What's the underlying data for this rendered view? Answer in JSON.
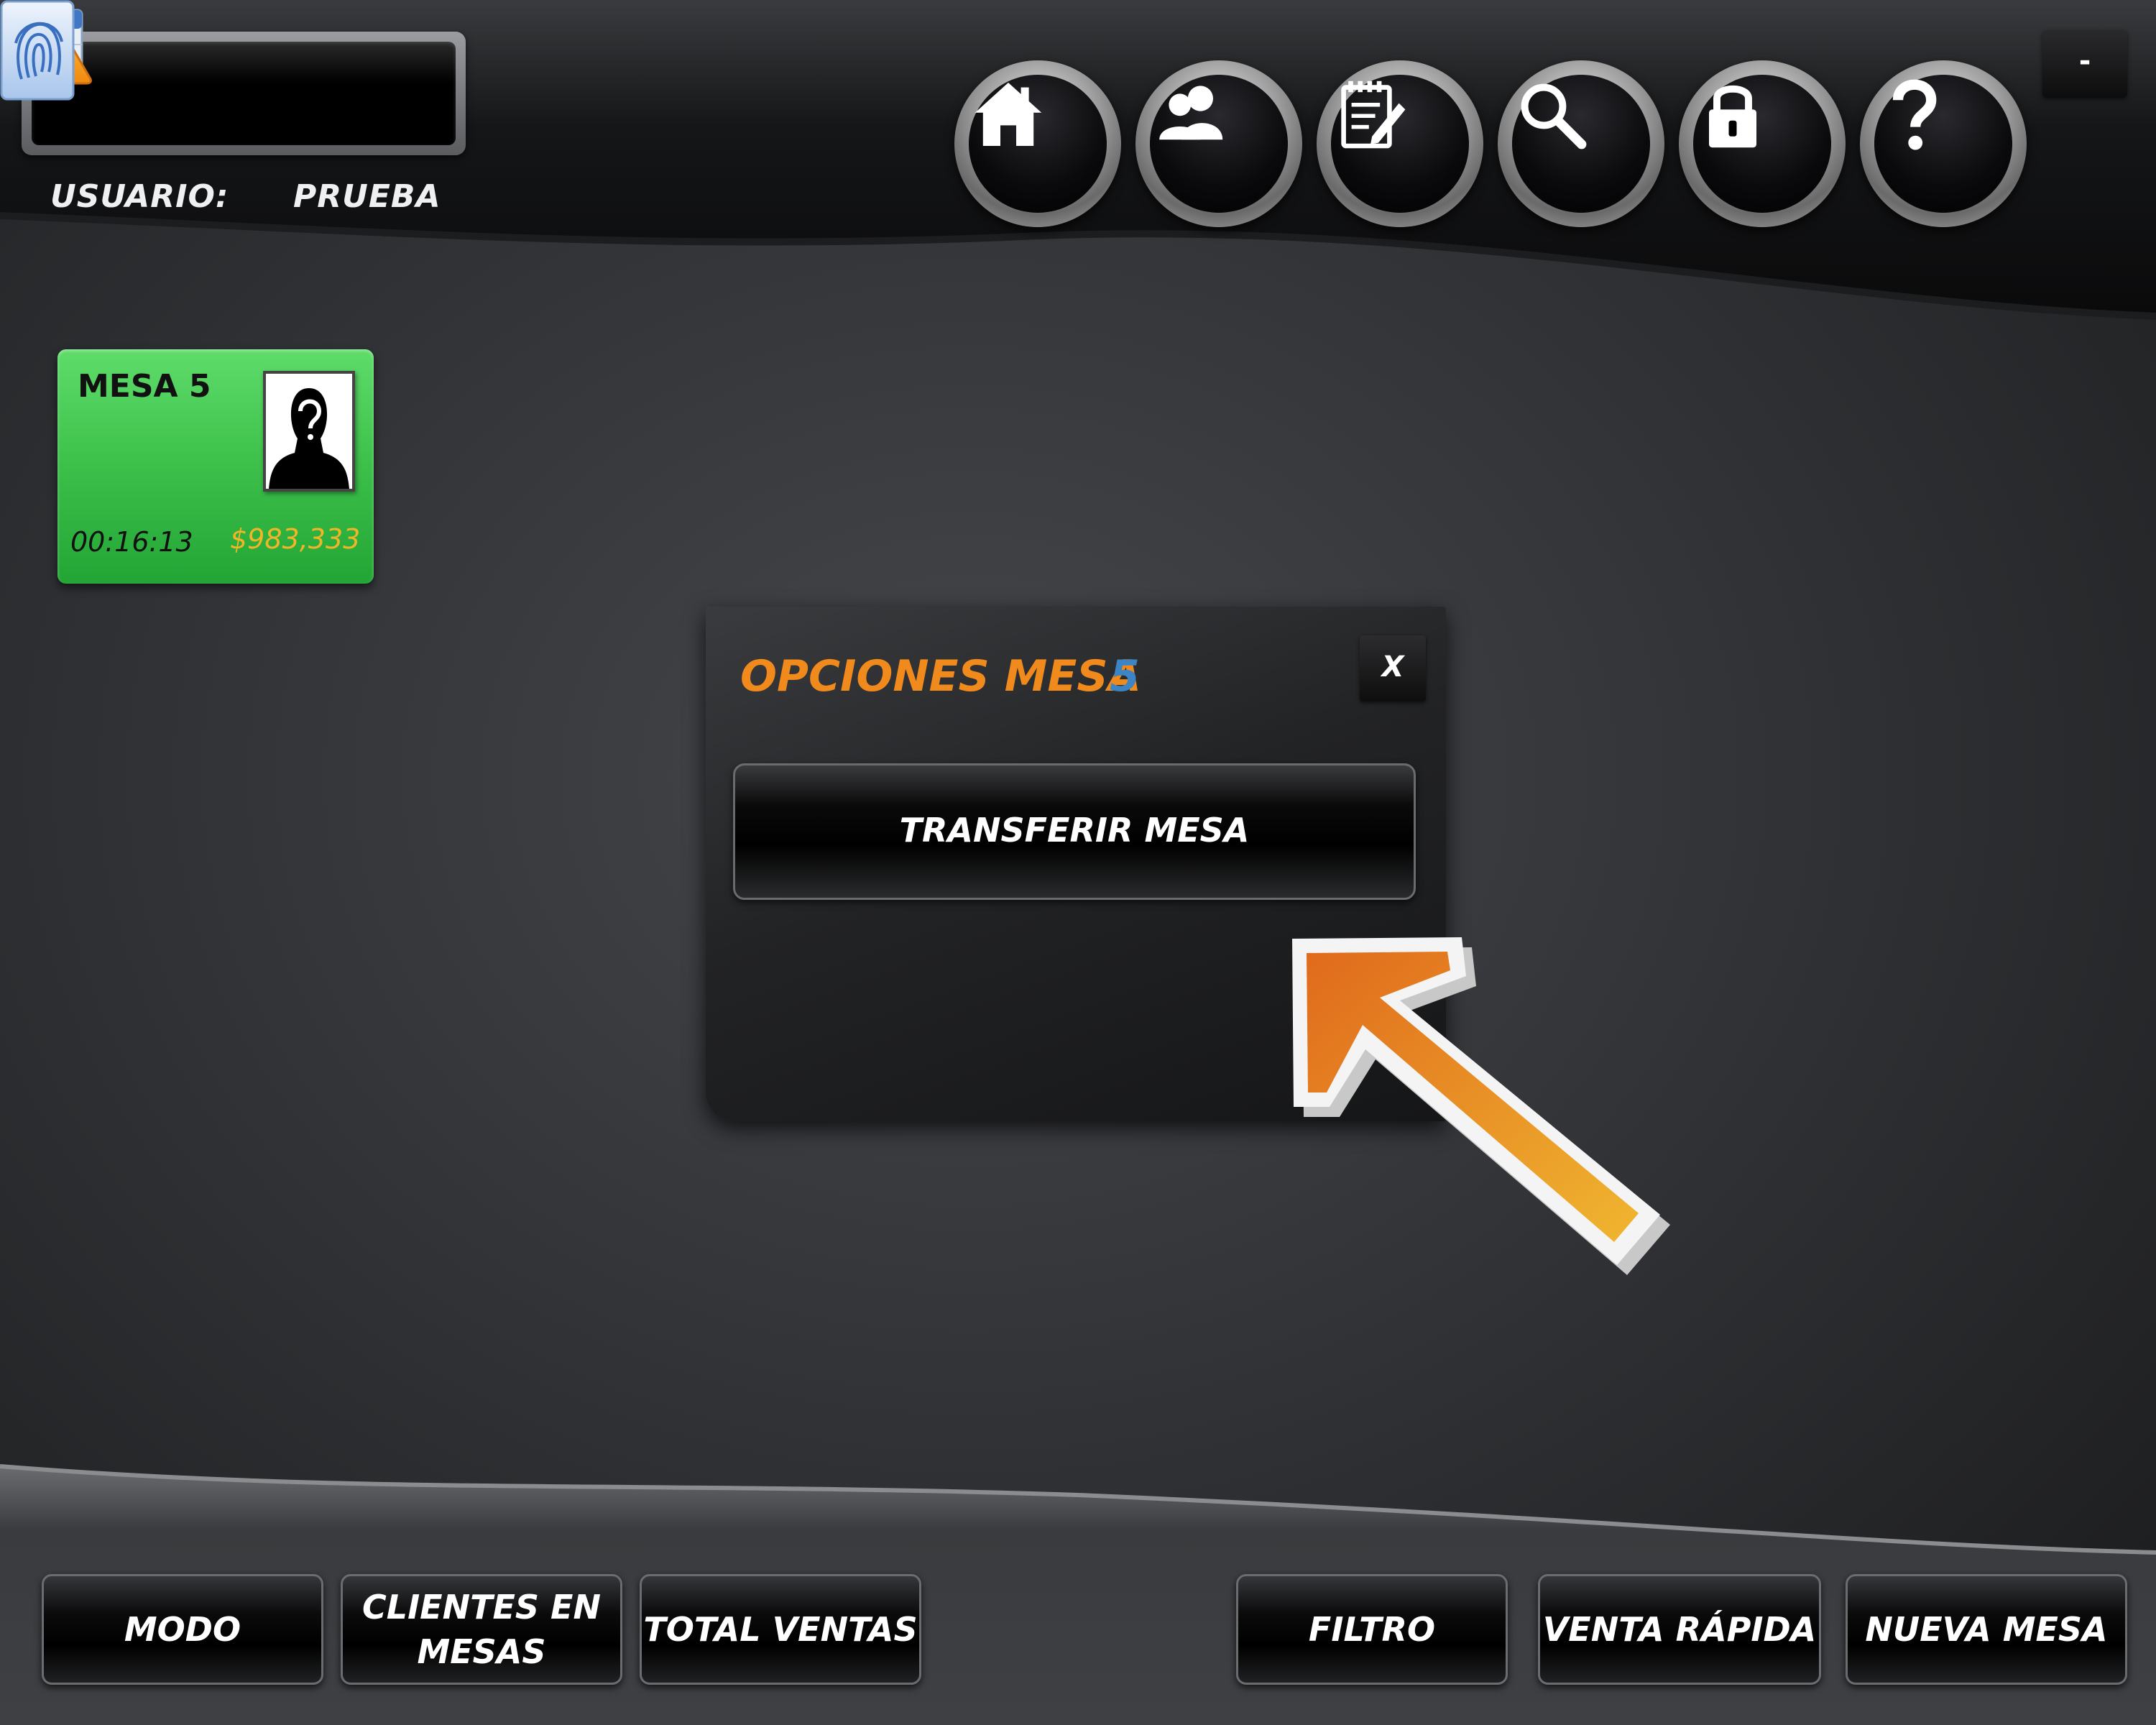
{
  "header": {
    "user_label": "USUARIO:",
    "user_value": "PRUEBA",
    "minimize_label": "-",
    "nav_icons": [
      "home-icon",
      "users-icon",
      "notepad-icon",
      "search-icon",
      "lock-icon",
      "help-icon"
    ]
  },
  "table": {
    "name": "MESA 5",
    "time": "00:16:13",
    "amount": "$983,333",
    "status_color": "#3cc04a"
  },
  "modal": {
    "title": "OPCIONES MESA",
    "table_number": "5",
    "close_label": "X",
    "action_label": "TRANSFERIR MESA",
    "title_color": "#f08a1c",
    "number_color": "#3c84c4"
  },
  "footer": {
    "mode": "MODO",
    "clients": "CLIENTES EN MESAS",
    "total_sales": "TOTAL VENTAS",
    "filter": "FILTRO",
    "quick_sale": "VENTA RÁPIDA",
    "new_table": "NUEVA MESA"
  },
  "colors": {
    "accent_orange": "#f08a1c",
    "amount_gold": "#f0b628"
  }
}
